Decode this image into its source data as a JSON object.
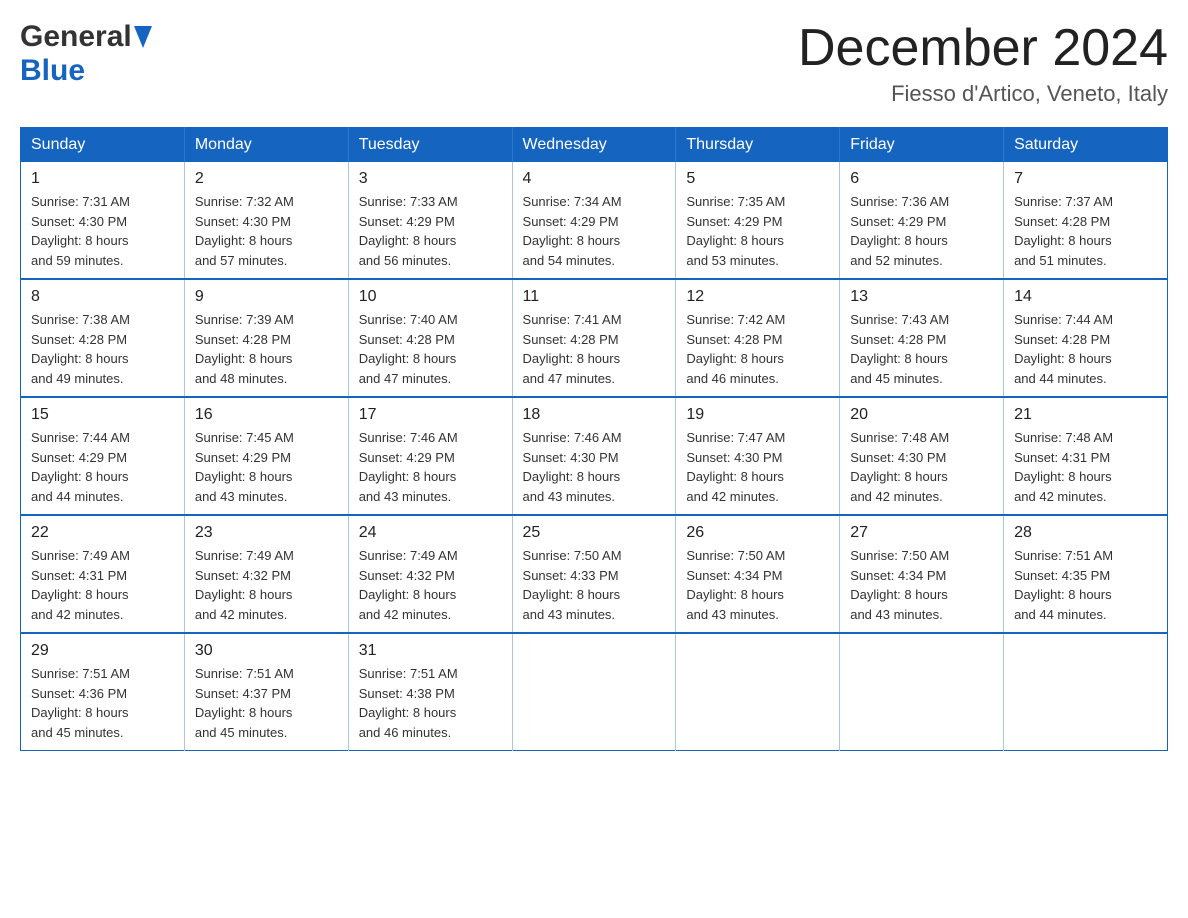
{
  "header": {
    "logo_general": "General",
    "logo_blue": "Blue",
    "main_title": "December 2024",
    "subtitle": "Fiesso d'Artico, Veneto, Italy"
  },
  "weekdays": [
    "Sunday",
    "Monday",
    "Tuesday",
    "Wednesday",
    "Thursday",
    "Friday",
    "Saturday"
  ],
  "weeks": [
    [
      {
        "day": "1",
        "sunrise": "7:31 AM",
        "sunset": "4:30 PM",
        "daylight": "8 hours and 59 minutes."
      },
      {
        "day": "2",
        "sunrise": "7:32 AM",
        "sunset": "4:30 PM",
        "daylight": "8 hours and 57 minutes."
      },
      {
        "day": "3",
        "sunrise": "7:33 AM",
        "sunset": "4:29 PM",
        "daylight": "8 hours and 56 minutes."
      },
      {
        "day": "4",
        "sunrise": "7:34 AM",
        "sunset": "4:29 PM",
        "daylight": "8 hours and 54 minutes."
      },
      {
        "day": "5",
        "sunrise": "7:35 AM",
        "sunset": "4:29 PM",
        "daylight": "8 hours and 53 minutes."
      },
      {
        "day": "6",
        "sunrise": "7:36 AM",
        "sunset": "4:29 PM",
        "daylight": "8 hours and 52 minutes."
      },
      {
        "day": "7",
        "sunrise": "7:37 AM",
        "sunset": "4:28 PM",
        "daylight": "8 hours and 51 minutes."
      }
    ],
    [
      {
        "day": "8",
        "sunrise": "7:38 AM",
        "sunset": "4:28 PM",
        "daylight": "8 hours and 49 minutes."
      },
      {
        "day": "9",
        "sunrise": "7:39 AM",
        "sunset": "4:28 PM",
        "daylight": "8 hours and 48 minutes."
      },
      {
        "day": "10",
        "sunrise": "7:40 AM",
        "sunset": "4:28 PM",
        "daylight": "8 hours and 47 minutes."
      },
      {
        "day": "11",
        "sunrise": "7:41 AM",
        "sunset": "4:28 PM",
        "daylight": "8 hours and 47 minutes."
      },
      {
        "day": "12",
        "sunrise": "7:42 AM",
        "sunset": "4:28 PM",
        "daylight": "8 hours and 46 minutes."
      },
      {
        "day": "13",
        "sunrise": "7:43 AM",
        "sunset": "4:28 PM",
        "daylight": "8 hours and 45 minutes."
      },
      {
        "day": "14",
        "sunrise": "7:44 AM",
        "sunset": "4:28 PM",
        "daylight": "8 hours and 44 minutes."
      }
    ],
    [
      {
        "day": "15",
        "sunrise": "7:44 AM",
        "sunset": "4:29 PM",
        "daylight": "8 hours and 44 minutes."
      },
      {
        "day": "16",
        "sunrise": "7:45 AM",
        "sunset": "4:29 PM",
        "daylight": "8 hours and 43 minutes."
      },
      {
        "day": "17",
        "sunrise": "7:46 AM",
        "sunset": "4:29 PM",
        "daylight": "8 hours and 43 minutes."
      },
      {
        "day": "18",
        "sunrise": "7:46 AM",
        "sunset": "4:30 PM",
        "daylight": "8 hours and 43 minutes."
      },
      {
        "day": "19",
        "sunrise": "7:47 AM",
        "sunset": "4:30 PM",
        "daylight": "8 hours and 42 minutes."
      },
      {
        "day": "20",
        "sunrise": "7:48 AM",
        "sunset": "4:30 PM",
        "daylight": "8 hours and 42 minutes."
      },
      {
        "day": "21",
        "sunrise": "7:48 AM",
        "sunset": "4:31 PM",
        "daylight": "8 hours and 42 minutes."
      }
    ],
    [
      {
        "day": "22",
        "sunrise": "7:49 AM",
        "sunset": "4:31 PM",
        "daylight": "8 hours and 42 minutes."
      },
      {
        "day": "23",
        "sunrise": "7:49 AM",
        "sunset": "4:32 PM",
        "daylight": "8 hours and 42 minutes."
      },
      {
        "day": "24",
        "sunrise": "7:49 AM",
        "sunset": "4:32 PM",
        "daylight": "8 hours and 42 minutes."
      },
      {
        "day": "25",
        "sunrise": "7:50 AM",
        "sunset": "4:33 PM",
        "daylight": "8 hours and 43 minutes."
      },
      {
        "day": "26",
        "sunrise": "7:50 AM",
        "sunset": "4:34 PM",
        "daylight": "8 hours and 43 minutes."
      },
      {
        "day": "27",
        "sunrise": "7:50 AM",
        "sunset": "4:34 PM",
        "daylight": "8 hours and 43 minutes."
      },
      {
        "day": "28",
        "sunrise": "7:51 AM",
        "sunset": "4:35 PM",
        "daylight": "8 hours and 44 minutes."
      }
    ],
    [
      {
        "day": "29",
        "sunrise": "7:51 AM",
        "sunset": "4:36 PM",
        "daylight": "8 hours and 45 minutes."
      },
      {
        "day": "30",
        "sunrise": "7:51 AM",
        "sunset": "4:37 PM",
        "daylight": "8 hours and 45 minutes."
      },
      {
        "day": "31",
        "sunrise": "7:51 AM",
        "sunset": "4:38 PM",
        "daylight": "8 hours and 46 minutes."
      },
      null,
      null,
      null,
      null
    ]
  ],
  "labels": {
    "sunrise": "Sunrise:",
    "sunset": "Sunset:",
    "daylight": "Daylight:"
  }
}
